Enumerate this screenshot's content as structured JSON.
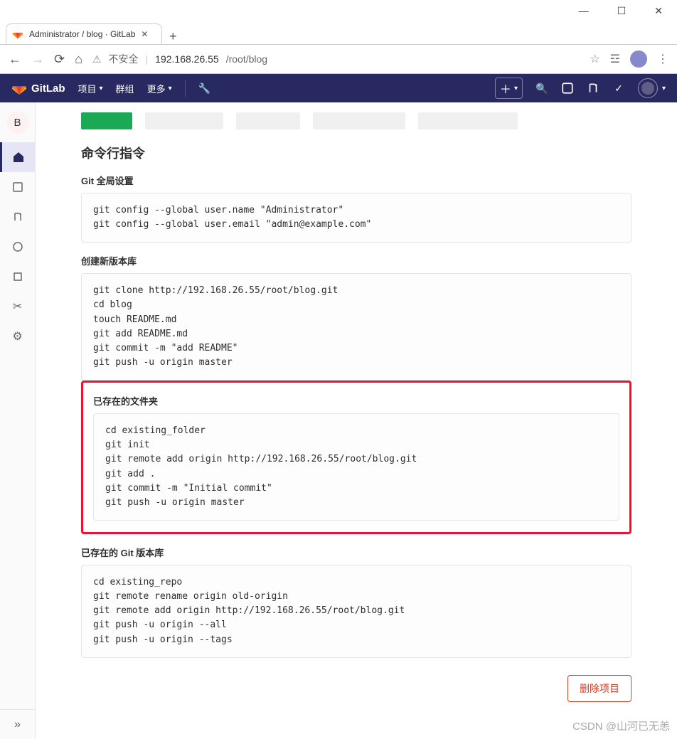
{
  "browser": {
    "tab_title": "Administrator / blog · GitLab",
    "new_tab": "+",
    "insecure_label": "不安全",
    "url_host": "192.168.26.55",
    "url_path": "/root/blog"
  },
  "navbar": {
    "brand": "GitLab",
    "items": [
      {
        "label": "项目",
        "caret": true
      },
      {
        "label": "群组",
        "caret": false
      },
      {
        "label": "更多",
        "caret": true
      }
    ]
  },
  "sidebar": {
    "project_letter": "B",
    "collapse": "»"
  },
  "main": {
    "heading": "命令行指令",
    "global_title": "Git 全局设置",
    "global_code": "git config --global user.name \"Administrator\"\ngit config --global user.email \"admin@example.com\"",
    "new_repo_title": "创建新版本库",
    "new_repo_code": "git clone http://192.168.26.55/root/blog.git\ncd blog\ntouch README.md\ngit add README.md\ngit commit -m \"add README\"\ngit push -u origin master",
    "existing_folder_title": "已存在的文件夹",
    "existing_folder_code": "cd existing_folder\ngit init\ngit remote add origin http://192.168.26.55/root/blog.git\ngit add .\ngit commit -m \"Initial commit\"\ngit push -u origin master",
    "existing_repo_title": "已存在的 Git 版本库",
    "existing_repo_code": "cd existing_repo\ngit remote rename origin old-origin\ngit remote add origin http://192.168.26.55/root/blog.git\ngit push -u origin --all\ngit push -u origin --tags",
    "delete_label": "删除项目"
  },
  "watermark": "CSDN @山河已无恙"
}
